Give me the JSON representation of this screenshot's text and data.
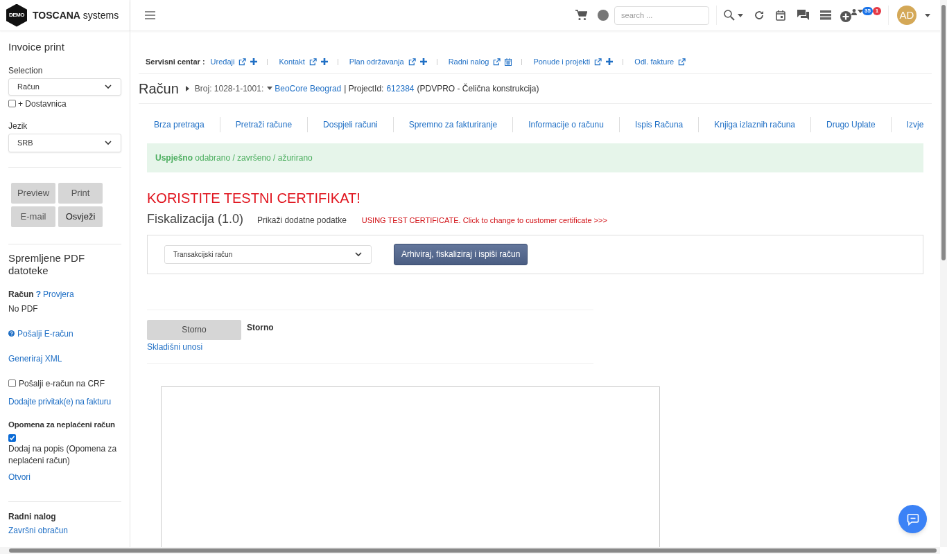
{
  "header": {
    "logo_badge": "DEMO",
    "brand_bold": "TOSCANA",
    "brand_rest": "systems",
    "search_placeholder": "search ...",
    "badges": [
      {
        "text": "35",
        "color": "#1a73e8"
      },
      {
        "text": "1",
        "color": "#e53945"
      }
    ],
    "avatar": "AD"
  },
  "sidebar": {
    "title": "Invoice print",
    "selection": {
      "label": "Selection",
      "value": "Račun"
    },
    "dostavnica": {
      "label": "+ Dostavnica",
      "checked": false
    },
    "language": {
      "label": "Jezik",
      "value": "SRB"
    },
    "buttons": [
      "Preview",
      "Print",
      "E-mail",
      "Osvježi"
    ],
    "saved_title": "Spremljene PDF datoteke",
    "racun": {
      "label": "Račun",
      "help": "?",
      "link": "Provjera",
      "status": "No PDF"
    },
    "send_einvoice": "Pošalji E-račun",
    "generate_xml": "Generiraj XML",
    "crf": {
      "label": "Pošalji e-račun na CRF",
      "checked": false
    },
    "attachments": "Dodajte privitak(e) na fakturu",
    "reminder": {
      "title": "Opomena za neplaćeni račun",
      "checked": true,
      "text": "Dodaj na popis (Opomena za neplaćeni račun)",
      "link": "Otvori"
    },
    "work_order": {
      "title": "Radni nalog",
      "link": "Završni obračun"
    }
  },
  "service_bar": {
    "label": "Servisni centar :",
    "links": [
      {
        "label": "Uređaji",
        "kind": "plus"
      },
      {
        "label": "Kontakt",
        "kind": "plus"
      },
      {
        "label": "Plan održavanja",
        "kind": "plus"
      },
      {
        "label": "Radni nalog",
        "kind": "calendar"
      },
      {
        "label": "Ponude i projekti",
        "kind": "plus"
      },
      {
        "label": "Odl. fakture"
      }
    ]
  },
  "breadcrumb": {
    "title": "Račun",
    "number": "Broj: 1028-1-1001:",
    "company": "BeoCore Beograd",
    "project_label": "| ProjectId:",
    "project_id": "612384",
    "project_desc": "(PDVPRO - Čelična konstrukcija)"
  },
  "tabs": [
    "Brza pretraga",
    "Pretraži račune",
    "Dospjeli računi",
    "Spremno za fakturiranje",
    "Informacije o računu",
    "Ispis Računa",
    "Knjiga izlaznih računa",
    "Drugo Uplate",
    "Izvje"
  ],
  "alert": "**Uspješno** odabrano / završeno / ažurirano",
  "warning": "KORISTITE TESTNI CERTIFIKAT!",
  "fiscal": {
    "title": "Fiskalizacija (1.0)",
    "extra": "Prikaži dodatne podatke",
    "test_note": "USING TEST CERTIFICATE. Click to change to customer certificate >>>",
    "select_value": "Transakcijski račun",
    "button": "Arhiviraj, fiskaliziraj i ispiši račun"
  },
  "storno": {
    "button": "Storno",
    "label": "Storno",
    "link": "Skladišni unosi"
  }
}
